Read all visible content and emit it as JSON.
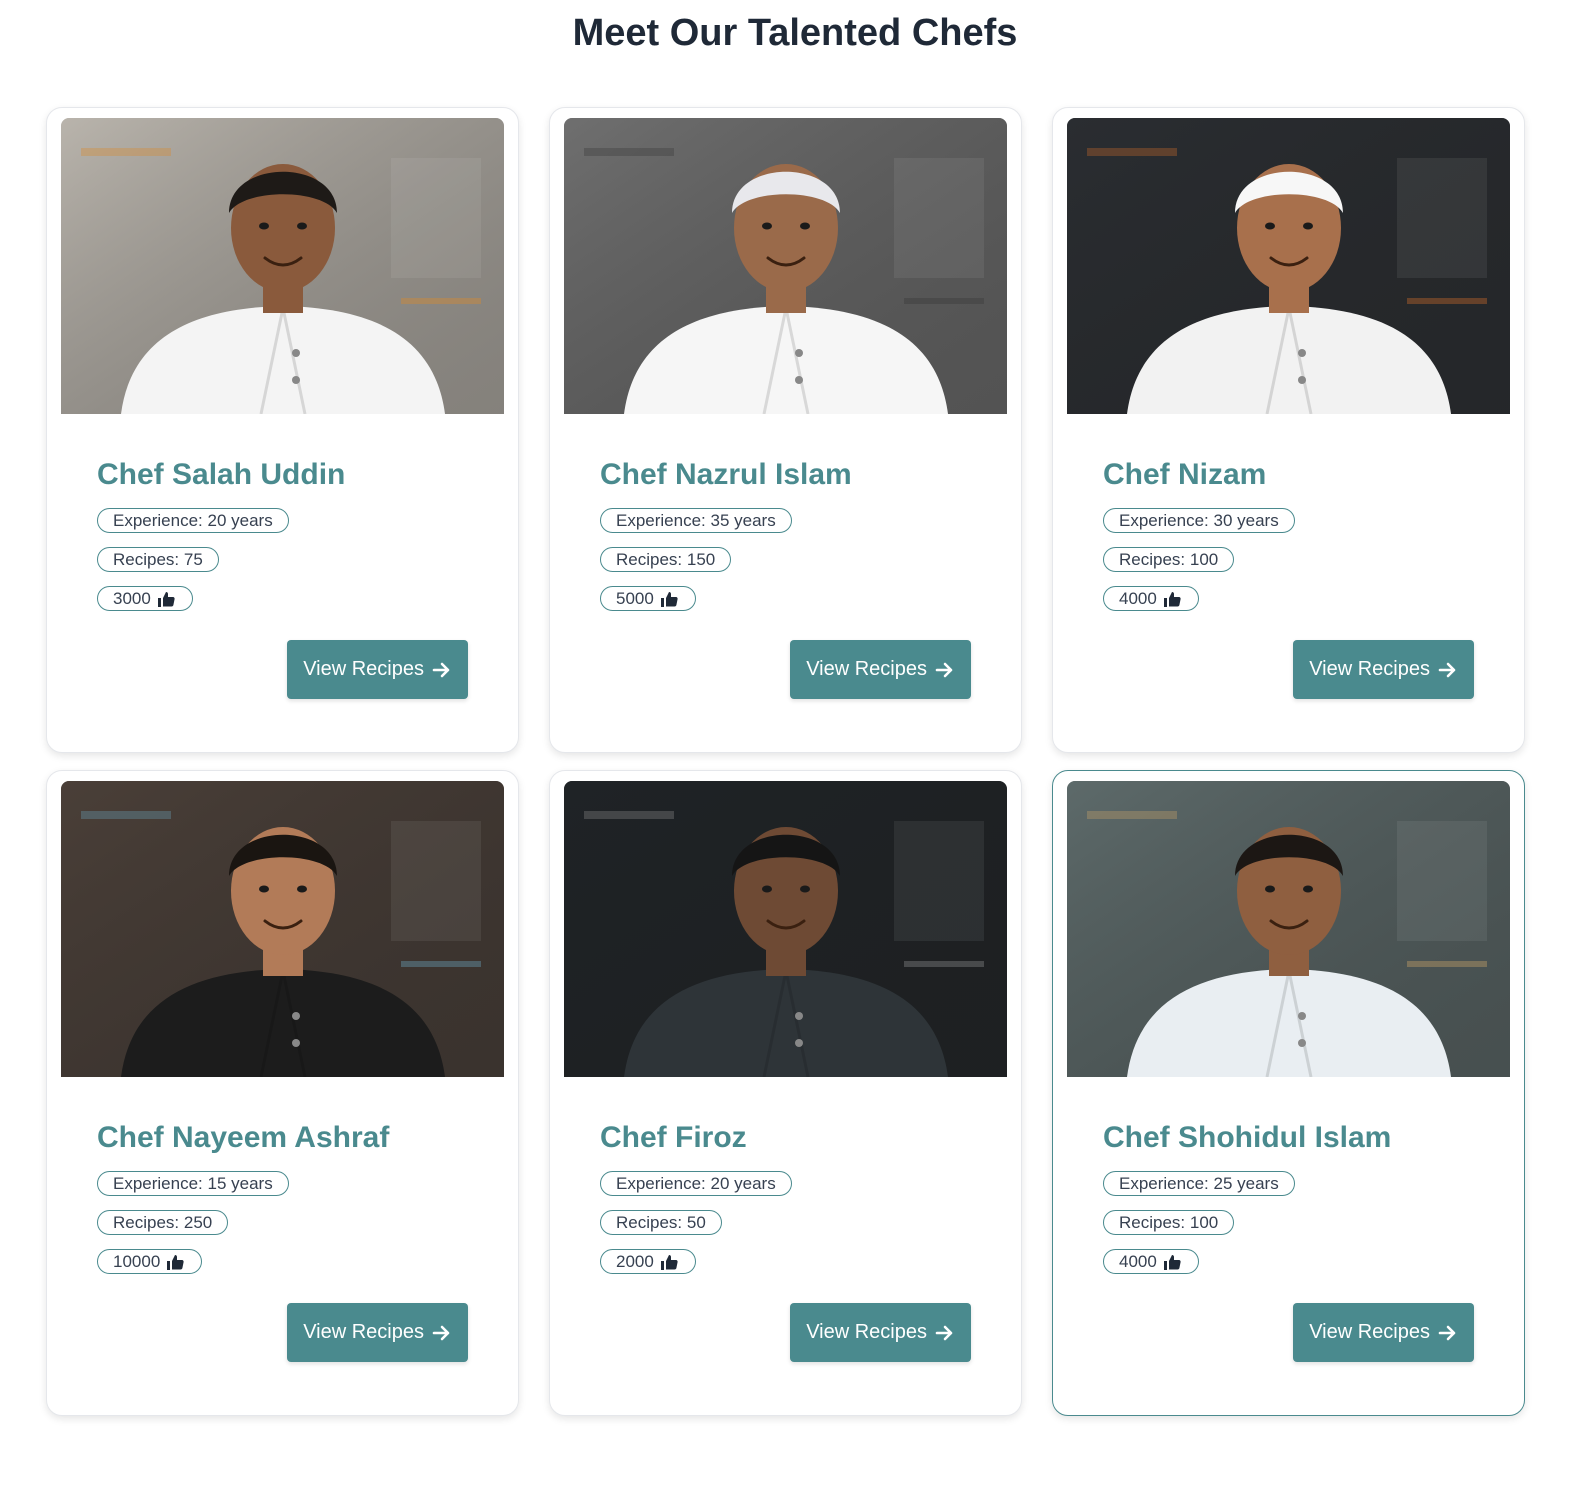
{
  "title": "Meet Our Talented Chefs",
  "button_label": "View Recipes",
  "chefs": [
    {
      "name": "Chef Salah Uddin",
      "experience": "Experience: 20 years",
      "recipes": "Recipes: 75",
      "likes": "3000",
      "photo": {
        "bg": "#b9b4ac",
        "skin": "#8a5a3c",
        "coat": "#f4f4f4",
        "hair": "#1e1a17",
        "accent": "#d98a2b"
      }
    },
    {
      "name": "Chef Nazrul Islam",
      "experience": "Experience: 35 years",
      "recipes": "Recipes: 150",
      "likes": "5000",
      "photo": {
        "bg": "#6f6f6f",
        "skin": "#9a6a4a",
        "coat": "#f6f6f6",
        "hair": "#e8e8ec",
        "accent": "#3a3a3a"
      }
    },
    {
      "name": "Chef Nizam",
      "experience": "Experience: 30 years",
      "recipes": "Recipes: 100",
      "likes": "4000",
      "photo": {
        "bg": "#2a2d31",
        "skin": "#a8704c",
        "coat": "#f2f2f2",
        "hair": "#f7f7f7",
        "accent": "#c86a2a"
      }
    },
    {
      "name": "Chef Nayeem Ashraf",
      "experience": "Experience: 15 years",
      "recipes": "Recipes: 250",
      "likes": "10000",
      "photo": {
        "bg": "#4a3f38",
        "skin": "#b27b58",
        "coat": "#1c1c1c",
        "hair": "#1a1511",
        "accent": "#6aa0b8"
      }
    },
    {
      "name": "Chef Firoz",
      "experience": "Experience: 20 years",
      "recipes": "Recipes: 50",
      "likes": "2000",
      "photo": {
        "bg": "#1f2326",
        "skin": "#6e4a34",
        "coat": "#2e3438",
        "hair": "#151515",
        "accent": "#8a8a8a"
      }
    },
    {
      "name": "Chef Shohidul Islam",
      "experience": "Experience: 25 years",
      "recipes": "Recipes: 100",
      "likes": "4000",
      "photo": {
        "bg": "#5d6a6a",
        "skin": "#8f5f40",
        "coat": "#e9eef2",
        "hair": "#1c1714",
        "accent": "#c9a36a"
      }
    }
  ],
  "colors": {
    "accent": "#4a8a8e",
    "title": "#1f2937",
    "badge_text": "#374151"
  },
  "icons": {
    "likes": "thumbs-up-icon",
    "button": "arrow-right-icon"
  }
}
